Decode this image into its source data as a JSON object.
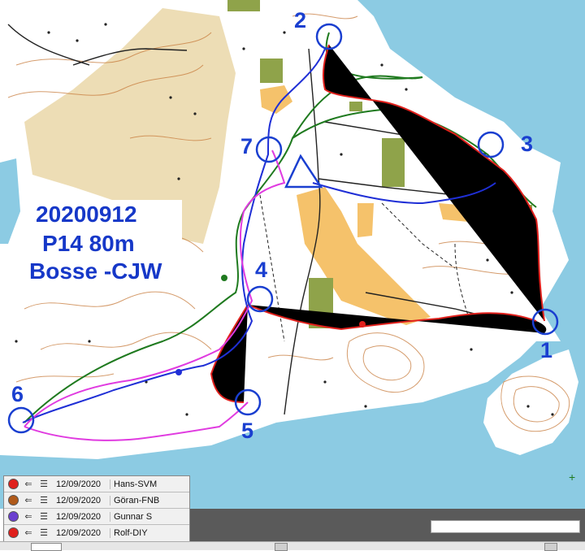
{
  "map": {
    "title_lines": [
      "20200912",
      "P14 80m",
      "Bosse -CJW"
    ],
    "controls": [
      {
        "label": "1"
      },
      {
        "label": "2"
      },
      {
        "label": "3"
      },
      {
        "label": "4"
      },
      {
        "label": "5"
      },
      {
        "label": "6"
      },
      {
        "label": "7"
      }
    ],
    "colors": {
      "water": "#8ccbe3",
      "open_land": "#f5c26b",
      "rough_open": "#ead7a8",
      "contour": "#c77b3c",
      "settlement": "#8fa34a",
      "course": "#1a3fd0",
      "route_red": "#e0201c",
      "route_green": "#1f7a1f",
      "route_blue": "#1f2fd6",
      "route_magenta": "#e03be0"
    }
  },
  "legend": {
    "rows": [
      {
        "date": "12/09/2020",
        "name": "Hans-SVM",
        "color": "#e0201c"
      },
      {
        "date": "12/09/2020",
        "name": "Göran-FNB",
        "color": "#b05a1a"
      },
      {
        "date": "12/09/2020",
        "name": "Gunnar S",
        "color": "#6a3fd0"
      },
      {
        "date": "12/09/2020",
        "name": "Rolf-DIY",
        "color": "#e0201c"
      }
    ]
  }
}
